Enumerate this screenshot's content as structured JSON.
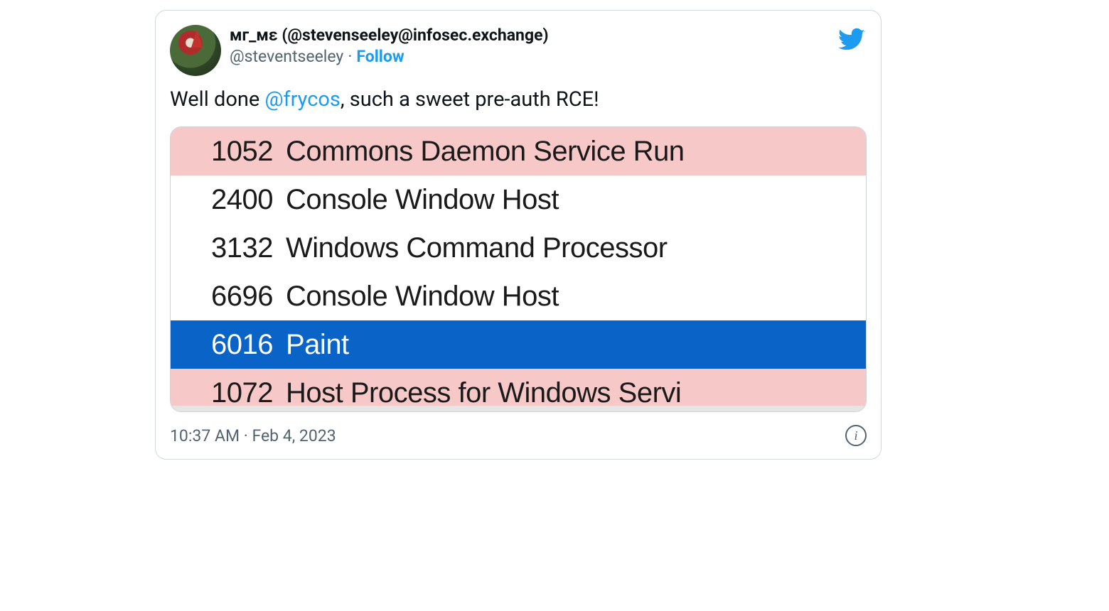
{
  "tweet": {
    "display_name": "мг_мε (@stevenseeley@infosec.exchange)",
    "handle": "@steventseeley",
    "follow_label": "Follow",
    "text_before_mention": "Well done ",
    "mention": "@frycos",
    "text_after_mention": ", such a sweet pre-auth RCE!",
    "timestamp": "10:37 AM · Feb 4, 2023"
  },
  "process_list": {
    "rows": [
      {
        "pid": "1052",
        "name": "Commons Daemon Service Run",
        "style": "pink"
      },
      {
        "pid": "2400",
        "name": "Console Window Host",
        "style": "white"
      },
      {
        "pid": "3132",
        "name": "Windows Command Processor",
        "style": "white"
      },
      {
        "pid": "6696",
        "name": "Console Window Host",
        "style": "white"
      },
      {
        "pid": "6016",
        "name": "Paint",
        "style": "blue"
      },
      {
        "pid": "1072",
        "name": "Host Process for Windows Servi",
        "style": "pink"
      }
    ]
  },
  "info_glyph": "i"
}
